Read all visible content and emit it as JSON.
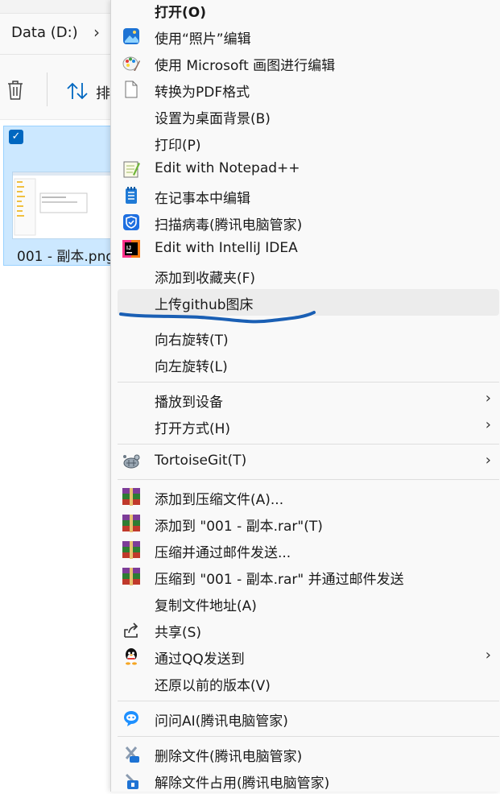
{
  "explorer": {
    "address_label": "Data (D:)",
    "address_chevron": "›",
    "sort_label": "排",
    "file_name": "001 - 副本.png",
    "file_check": "✓"
  },
  "menu": {
    "items": [
      {
        "label": "打开(O)",
        "icon": "none"
      },
      {
        "label": "使用“照片”编辑",
        "icon": "photos-icon"
      },
      {
        "label": "使用 Microsoft 画图进行编辑",
        "icon": "paint-icon"
      },
      {
        "label": "转换为PDF格式",
        "icon": "document-icon"
      },
      {
        "label": "设置为桌面背景(B)",
        "icon": "none"
      },
      {
        "label": "打印(P)",
        "icon": "none"
      },
      {
        "label": "Edit with Notepad++",
        "icon": "notepad-plus-plus-icon"
      },
      {
        "label": "在记事本中编辑",
        "icon": "notepad-icon"
      },
      {
        "label": "扫描病毒(腾讯电脑管家)",
        "icon": "shield-icon"
      },
      {
        "label": "Edit with IntelliJ IDEA",
        "icon": "intellij-icon"
      },
      {
        "label": "添加到收藏夹(F)",
        "icon": "none"
      },
      {
        "label": "上传github图床",
        "icon": "none"
      },
      {
        "label": "向右旋转(T)",
        "icon": "none"
      },
      {
        "label": "向左旋转(L)",
        "icon": "none"
      },
      {
        "label": "播放到设备",
        "icon": "none"
      },
      {
        "label": "打开方式(H)",
        "icon": "none"
      },
      {
        "label": "TortoiseGit(T)",
        "icon": "tortoisegit-icon"
      },
      {
        "label": "添加到压缩文件(A)...",
        "icon": "winrar-icon"
      },
      {
        "label": "添加到 \"001 - 副本.rar\"(T)",
        "icon": "winrar-icon"
      },
      {
        "label": "压缩并通过邮件发送...",
        "icon": "winrar-icon"
      },
      {
        "label": "压缩到 \"001 - 副本.rar\" 并通过邮件发送",
        "icon": "winrar-icon"
      },
      {
        "label": "复制文件地址(A)",
        "icon": "none"
      },
      {
        "label": "共享(S)",
        "icon": "share-icon"
      },
      {
        "label": "通过QQ发送到",
        "icon": "qq-icon"
      },
      {
        "label": "还原以前的版本(V)",
        "icon": "none"
      },
      {
        "label": "问问AI(腾讯电脑管家)",
        "icon": "ai-chat-icon"
      },
      {
        "label": "删除文件(腾讯电脑管家)",
        "icon": "delete-file-icon"
      },
      {
        "label": "解除文件占用(腾讯电脑管家)",
        "icon": "unlock-file-icon"
      }
    ],
    "submenu_arrow": "›",
    "accent_color": "#0067c0",
    "annotation_color": "#1a5fb4"
  }
}
